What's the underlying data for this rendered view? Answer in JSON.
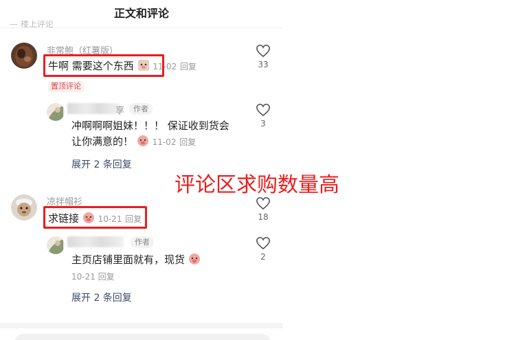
{
  "header": {
    "title": "正文和评论"
  },
  "top_fragment": "— 楼上评论",
  "comments": [
    {
      "user": "非常鲍（红薯版）",
      "text": "牛啊 需要这个东西",
      "date": "11-02",
      "reply_label": "回复",
      "pin_label": "置顶评论",
      "likes": "33",
      "reply": {
        "name_suffix": "享",
        "badge": "作者",
        "line1": "冲啊啊啊姐妹！！！ 保证收到货会",
        "line2": "让你满意的！",
        "date": "11-02",
        "reply_label": "回复",
        "likes": "3"
      },
      "expand_label": "展开 2 条回复"
    },
    {
      "user": "凉拌帽衫",
      "text": "求链接",
      "date": "10-21",
      "reply_label": "回复",
      "likes": "18",
      "reply": {
        "badge": "作者",
        "line1": "主页店铺里面就有，现货",
        "date": "10-21",
        "reply_label": "回复",
        "likes": "2"
      },
      "expand_label": "展开 2 条回复"
    }
  ],
  "annotation": "评论区求购数量高",
  "colors": {
    "highlight": "#ee1c1c",
    "expand_link": "#3a4a66",
    "pin": "#e0484f"
  },
  "icons": [
    "heart-outline-icon",
    "pig-face-emoji-icon"
  ]
}
